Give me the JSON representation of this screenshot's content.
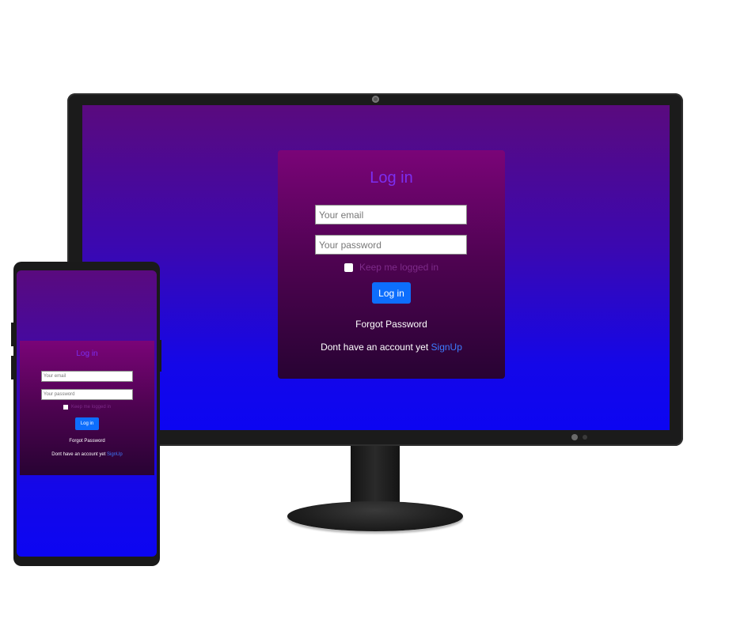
{
  "desktop_login": {
    "title": "Log in",
    "email_placeholder": "Your email",
    "password_placeholder": "Your password",
    "remember_label": "Keep me logged in",
    "login_button": "Log in",
    "forgot_password": "Forgot Password",
    "signup_prompt": "Dont have an account yet",
    "signup_link": "SignUp"
  },
  "mobile_login": {
    "title": "Log in",
    "email_placeholder": "Your email",
    "password_placeholder": "Your password",
    "remember_label": "Keep me logged in",
    "login_button": "Log in",
    "forgot_password": "Forgot Password",
    "signup_prompt": "Dont have an account yet",
    "signup_link": "SignUp"
  },
  "colors": {
    "title": "#7b2ff0",
    "button": "#0d6efd",
    "link": "#3d7bff",
    "card_top": "#7a0478",
    "card_bottom": "#280333",
    "screen_top": "#5a0a7e",
    "screen_bottom": "#0c05f2"
  }
}
